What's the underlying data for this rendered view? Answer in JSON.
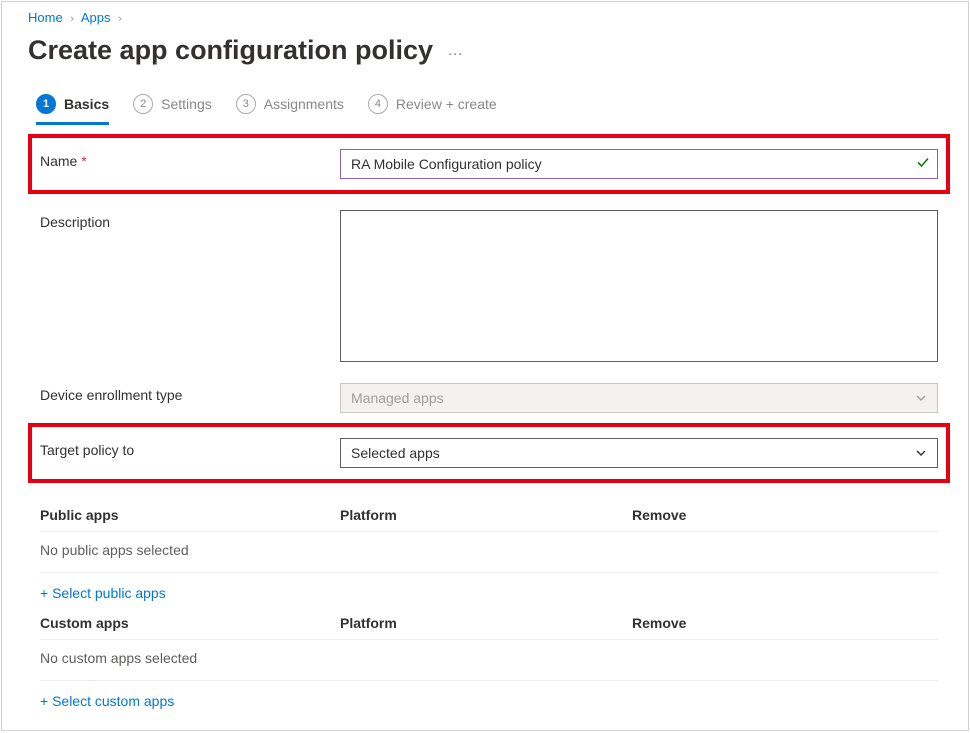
{
  "breadcrumb": {
    "items": [
      "Home",
      "Apps"
    ]
  },
  "header": {
    "title": "Create app configuration policy",
    "more": "…"
  },
  "tabs": [
    {
      "num": "1",
      "label": "Basics",
      "active": true
    },
    {
      "num": "2",
      "label": "Settings",
      "active": false
    },
    {
      "num": "3",
      "label": "Assignments",
      "active": false
    },
    {
      "num": "4",
      "label": "Review + create",
      "active": false
    }
  ],
  "form": {
    "name_label": "Name",
    "name_value": "RA Mobile Configuration policy",
    "desc_label": "Description",
    "desc_value": "",
    "enroll_label": "Device enrollment type",
    "enroll_value": "Managed apps",
    "target_label": "Target policy to",
    "target_value": "Selected apps"
  },
  "public": {
    "header": {
      "col1": "Public apps",
      "col2": "Platform",
      "col3": "Remove"
    },
    "empty": "No public apps selected",
    "link": "+ Select public apps"
  },
  "custom": {
    "header": {
      "col1": "Custom apps",
      "col2": "Platform",
      "col3": "Remove"
    },
    "empty": "No custom apps selected",
    "link": "+ Select custom apps"
  }
}
